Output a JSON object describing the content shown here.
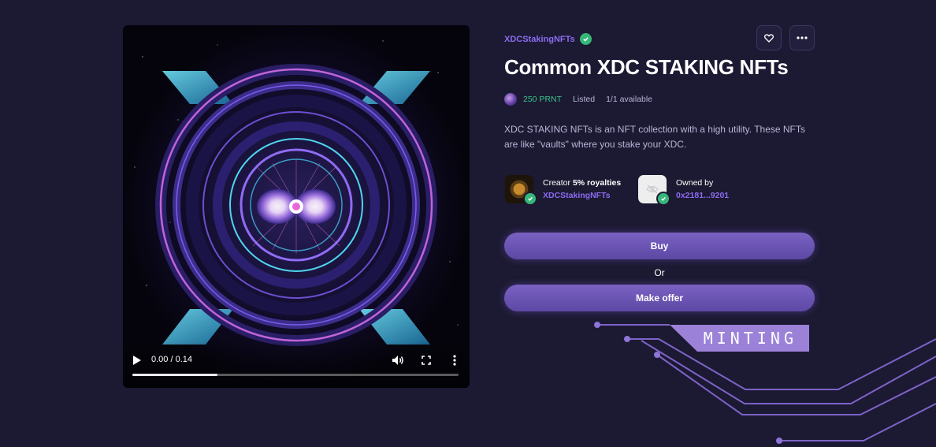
{
  "media": {
    "time_current": "0.00",
    "time_total": "0.14",
    "progress": 0.26,
    "icons": [
      "play-icon",
      "volume-icon",
      "fullscreen-icon",
      "more-vertical-icon"
    ]
  },
  "header": {
    "collection_name": "XDCStakingNFTs",
    "favorite_icon": "heart-icon",
    "more_icon": "more-horizontal-icon"
  },
  "title": "Common XDC STAKING NFTs",
  "listing": {
    "price": "250 PRNT",
    "status": "Listed",
    "availability": "1/1 available"
  },
  "description": "XDC STAKING NFTs is an NFT collection with a high utility. These NFTs are like \"vaults\" where you stake your XDC.",
  "creator": {
    "label": "Creator",
    "royalties": "5% royalties",
    "name": "XDCStakingNFTs"
  },
  "owner": {
    "label": "Owned by",
    "address": "0x2181...9201"
  },
  "actions": {
    "buy_label": "Buy",
    "or_label": "Or",
    "offer_label": "Make offer"
  },
  "banner": {
    "text": "MINTING"
  },
  "colors": {
    "background": "#1c1932",
    "accent": "#8b6cf0",
    "price": "#37c28b",
    "verified": "#36b779",
    "button": "#6a53b3"
  }
}
